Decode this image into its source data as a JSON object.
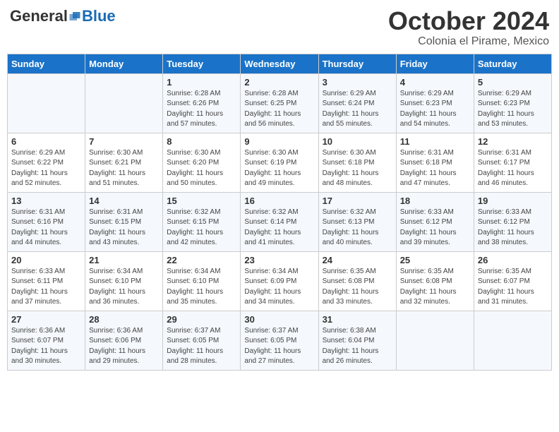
{
  "logo": {
    "general": "General",
    "blue": "Blue"
  },
  "header": {
    "month": "October 2024",
    "location": "Colonia el Pirame, Mexico"
  },
  "days_of_week": [
    "Sunday",
    "Monday",
    "Tuesday",
    "Wednesday",
    "Thursday",
    "Friday",
    "Saturday"
  ],
  "weeks": [
    [
      {
        "day": "",
        "info": ""
      },
      {
        "day": "",
        "info": ""
      },
      {
        "day": "1",
        "info": "Sunrise: 6:28 AM\nSunset: 6:26 PM\nDaylight: 11 hours and 57 minutes."
      },
      {
        "day": "2",
        "info": "Sunrise: 6:28 AM\nSunset: 6:25 PM\nDaylight: 11 hours and 56 minutes."
      },
      {
        "day": "3",
        "info": "Sunrise: 6:29 AM\nSunset: 6:24 PM\nDaylight: 11 hours and 55 minutes."
      },
      {
        "day": "4",
        "info": "Sunrise: 6:29 AM\nSunset: 6:23 PM\nDaylight: 11 hours and 54 minutes."
      },
      {
        "day": "5",
        "info": "Sunrise: 6:29 AM\nSunset: 6:23 PM\nDaylight: 11 hours and 53 minutes."
      }
    ],
    [
      {
        "day": "6",
        "info": "Sunrise: 6:29 AM\nSunset: 6:22 PM\nDaylight: 11 hours and 52 minutes."
      },
      {
        "day": "7",
        "info": "Sunrise: 6:30 AM\nSunset: 6:21 PM\nDaylight: 11 hours and 51 minutes."
      },
      {
        "day": "8",
        "info": "Sunrise: 6:30 AM\nSunset: 6:20 PM\nDaylight: 11 hours and 50 minutes."
      },
      {
        "day": "9",
        "info": "Sunrise: 6:30 AM\nSunset: 6:19 PM\nDaylight: 11 hours and 49 minutes."
      },
      {
        "day": "10",
        "info": "Sunrise: 6:30 AM\nSunset: 6:18 PM\nDaylight: 11 hours and 48 minutes."
      },
      {
        "day": "11",
        "info": "Sunrise: 6:31 AM\nSunset: 6:18 PM\nDaylight: 11 hours and 47 minutes."
      },
      {
        "day": "12",
        "info": "Sunrise: 6:31 AM\nSunset: 6:17 PM\nDaylight: 11 hours and 46 minutes."
      }
    ],
    [
      {
        "day": "13",
        "info": "Sunrise: 6:31 AM\nSunset: 6:16 PM\nDaylight: 11 hours and 44 minutes."
      },
      {
        "day": "14",
        "info": "Sunrise: 6:31 AM\nSunset: 6:15 PM\nDaylight: 11 hours and 43 minutes."
      },
      {
        "day": "15",
        "info": "Sunrise: 6:32 AM\nSunset: 6:15 PM\nDaylight: 11 hours and 42 minutes."
      },
      {
        "day": "16",
        "info": "Sunrise: 6:32 AM\nSunset: 6:14 PM\nDaylight: 11 hours and 41 minutes."
      },
      {
        "day": "17",
        "info": "Sunrise: 6:32 AM\nSunset: 6:13 PM\nDaylight: 11 hours and 40 minutes."
      },
      {
        "day": "18",
        "info": "Sunrise: 6:33 AM\nSunset: 6:12 PM\nDaylight: 11 hours and 39 minutes."
      },
      {
        "day": "19",
        "info": "Sunrise: 6:33 AM\nSunset: 6:12 PM\nDaylight: 11 hours and 38 minutes."
      }
    ],
    [
      {
        "day": "20",
        "info": "Sunrise: 6:33 AM\nSunset: 6:11 PM\nDaylight: 11 hours and 37 minutes."
      },
      {
        "day": "21",
        "info": "Sunrise: 6:34 AM\nSunset: 6:10 PM\nDaylight: 11 hours and 36 minutes."
      },
      {
        "day": "22",
        "info": "Sunrise: 6:34 AM\nSunset: 6:10 PM\nDaylight: 11 hours and 35 minutes."
      },
      {
        "day": "23",
        "info": "Sunrise: 6:34 AM\nSunset: 6:09 PM\nDaylight: 11 hours and 34 minutes."
      },
      {
        "day": "24",
        "info": "Sunrise: 6:35 AM\nSunset: 6:08 PM\nDaylight: 11 hours and 33 minutes."
      },
      {
        "day": "25",
        "info": "Sunrise: 6:35 AM\nSunset: 6:08 PM\nDaylight: 11 hours and 32 minutes."
      },
      {
        "day": "26",
        "info": "Sunrise: 6:35 AM\nSunset: 6:07 PM\nDaylight: 11 hours and 31 minutes."
      }
    ],
    [
      {
        "day": "27",
        "info": "Sunrise: 6:36 AM\nSunset: 6:07 PM\nDaylight: 11 hours and 30 minutes."
      },
      {
        "day": "28",
        "info": "Sunrise: 6:36 AM\nSunset: 6:06 PM\nDaylight: 11 hours and 29 minutes."
      },
      {
        "day": "29",
        "info": "Sunrise: 6:37 AM\nSunset: 6:05 PM\nDaylight: 11 hours and 28 minutes."
      },
      {
        "day": "30",
        "info": "Sunrise: 6:37 AM\nSunset: 6:05 PM\nDaylight: 11 hours and 27 minutes."
      },
      {
        "day": "31",
        "info": "Sunrise: 6:38 AM\nSunset: 6:04 PM\nDaylight: 11 hours and 26 minutes."
      },
      {
        "day": "",
        "info": ""
      },
      {
        "day": "",
        "info": ""
      }
    ]
  ]
}
